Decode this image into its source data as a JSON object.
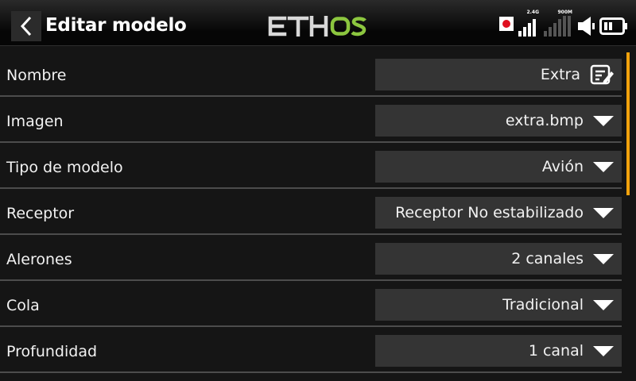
{
  "header": {
    "title": "Editar modelo",
    "logo": "ETHOS",
    "signal_24_label": "2.4G",
    "signal_900_label": "900M",
    "accent_color": "#8cc63f",
    "record_color": "#e01020"
  },
  "rows": [
    {
      "label": "Nombre",
      "value": "Extra",
      "control": "edit-icon"
    },
    {
      "label": "Imagen",
      "value": "extra.bmp",
      "control": "dropdown"
    },
    {
      "label": "Tipo de modelo",
      "value": "Avión",
      "control": "dropdown"
    },
    {
      "label": "Receptor",
      "value": "Receptor No estabilizado",
      "control": "dropdown"
    },
    {
      "label": "Alerones",
      "value": "2 canales",
      "control": "dropdown"
    },
    {
      "label": "Cola",
      "value": "Tradicional",
      "control": "dropdown"
    },
    {
      "label": "Profundidad",
      "value": "1 canal",
      "control": "dropdown"
    }
  ],
  "scrollbar_color": "#f2a20c"
}
